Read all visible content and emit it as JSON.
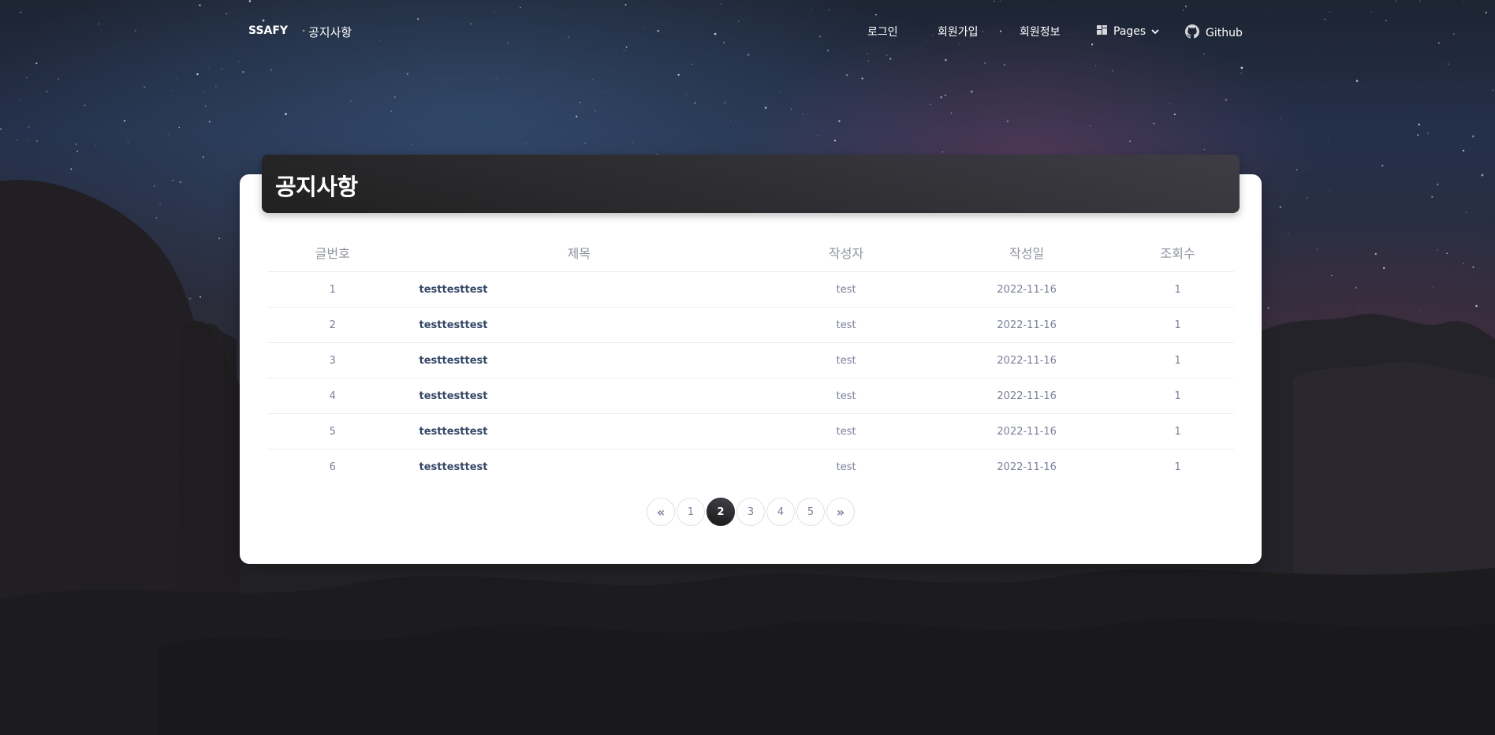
{
  "navbar": {
    "brand": "SSAFY",
    "notice": "공지사항",
    "links": {
      "login": "로그인",
      "signup": "회원가입",
      "member_info": "회원정보",
      "pages": "Pages",
      "github": "Github"
    }
  },
  "card": {
    "title": "공지사항"
  },
  "table": {
    "headers": {
      "no": "글번호",
      "title": "제목",
      "writer": "작성자",
      "date": "작성일",
      "views": "조회수"
    },
    "rows": [
      {
        "no": "1",
        "title": "testtesttest",
        "writer": "test",
        "date": "2022-11-16",
        "views": "1"
      },
      {
        "no": "2",
        "title": "testtesttest",
        "writer": "test",
        "date": "2022-11-16",
        "views": "1"
      },
      {
        "no": "3",
        "title": "testtesttest",
        "writer": "test",
        "date": "2022-11-16",
        "views": "1"
      },
      {
        "no": "4",
        "title": "testtesttest",
        "writer": "test",
        "date": "2022-11-16",
        "views": "1"
      },
      {
        "no": "5",
        "title": "testtesttest",
        "writer": "test",
        "date": "2022-11-16",
        "views": "1"
      },
      {
        "no": "6",
        "title": "testtesttest",
        "writer": "test",
        "date": "2022-11-16",
        "views": "1"
      }
    ]
  },
  "pagination": {
    "prev": "«",
    "pages": [
      "1",
      "2",
      "3",
      "4",
      "5"
    ],
    "active": "2",
    "next": "»"
  }
}
